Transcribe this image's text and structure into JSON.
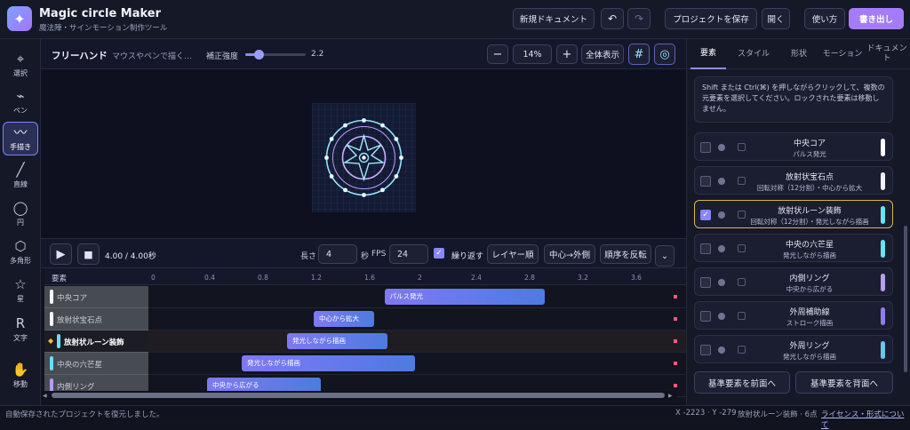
{
  "header": {
    "app_title": "Magic circle Maker",
    "app_subtitle": "魔法陣・サインモーション制作ツール",
    "new_doc": "新規ドキュメント",
    "undo": "↶",
    "redo": "↷",
    "save_project": "プロジェクトを保存",
    "open": "開く",
    "howto": "使い方",
    "export": "書き出し"
  },
  "tools": [
    {
      "icon": "⌖",
      "label": "選択"
    },
    {
      "icon": "⌁",
      "label": "ペン"
    },
    {
      "icon": "〰",
      "label": "手描き"
    },
    {
      "icon": "╱",
      "label": "直線"
    },
    {
      "icon": "◯",
      "label": "円"
    },
    {
      "icon": "⬡",
      "label": "多角形"
    },
    {
      "icon": "☆",
      "label": "星"
    },
    {
      "icon": "R",
      "label": "文字"
    },
    {
      "icon": "✋",
      "label": "移動"
    }
  ],
  "toolbar": {
    "mode_title": "フリーハンド",
    "mode_hint": "マウスやペンで描く…",
    "strength_label": "補正強度",
    "strength_value": "2.2",
    "strength_fraction": 0.22,
    "zoom_minus": "−",
    "zoom_value": "14%",
    "zoom_plus": "+",
    "fit_all": "全体表示"
  },
  "playback": {
    "time": "4.00 / 4.00秒",
    "length_label": "長さ",
    "length_value": "4",
    "sec_label": "秒",
    "fps_label": "FPS",
    "fps_value": "24",
    "repeat_label": "繰り返す",
    "layer_order": "レイヤー順",
    "center_out": "中心→外側",
    "reverse": "順序を反転",
    "more": "⌄"
  },
  "timeline": {
    "header_label": "要素",
    "ticks": [
      "0",
      "0.4",
      "0.8",
      "1.2",
      "1.6",
      "2",
      "2.4",
      "2.8",
      "3.2",
      "3.6"
    ],
    "rows": [
      {
        "name": "中央コア",
        "color": "#ffffff",
        "bar_label": "パルス発光",
        "start": 1.75,
        "end": 2.95,
        "selected": false
      },
      {
        "name": "放射状宝石点",
        "color": "#ffffff",
        "bar_label": "中心から拡大",
        "start": 1.22,
        "end": 1.67,
        "selected": false
      },
      {
        "name": "放射状ルーン装飾",
        "color": "#66e0f2",
        "bar_label": "発光しながら描画",
        "start": 1.02,
        "end": 1.77,
        "selected": true
      },
      {
        "name": "中央の六芒星",
        "color": "#66e0f2",
        "bar_label": "発光しながら描画",
        "start": 0.68,
        "end": 1.98,
        "selected": false
      },
      {
        "name": "内側リング",
        "color": "#b69cf5",
        "bar_label": "中央から広がる",
        "start": 0.42,
        "end": 1.27,
        "selected": false
      }
    ]
  },
  "right_panel": {
    "tabs": [
      "要素",
      "スタイル",
      "形状",
      "モーション",
      "ドキュメント"
    ],
    "info": "Shift または Ctrl(⌘) を押しながらクリックして、複数の元要素を選択してください。ロックされた要素は移動しません。",
    "elements": [
      {
        "name": "中央コア",
        "desc": "パルス発光",
        "color": "#ffffff",
        "checked": false
      },
      {
        "name": "放射状宝石点",
        "desc": "回転対称（12分割）・中心から拡大",
        "color": "#f4f0ff",
        "checked": false
      },
      {
        "name": "放射状ルーン装飾",
        "desc": "回転対称（12分割）・発光しながら描画",
        "color": "#67e3f2",
        "checked": true
      },
      {
        "name": "中央の六芒星",
        "desc": "発光しながら描画",
        "color": "#67e3f2",
        "checked": false
      },
      {
        "name": "内側リング",
        "desc": "中央から広がる",
        "color": "#b89cf6",
        "checked": false
      },
      {
        "name": "外周補助線",
        "desc": "ストローク描画",
        "color": "#8f7cf2",
        "checked": false
      },
      {
        "name": "外周リング",
        "desc": "発光しながら描画",
        "color": "#67c6ee",
        "checked": false
      }
    ],
    "to_front": "基準要素を前面へ",
    "to_back": "基準要素を背面へ"
  },
  "status": {
    "left": "自動保存されたプロジェクトを復元しました。",
    "coords": "X -2223 · Y -279",
    "selection": "放射状ルーン装飾 · 6点",
    "license": "ライセンス・形式について"
  },
  "colors": {
    "accent": "#8a8dff",
    "export": "#a57cf7",
    "glow": "#66e0f2"
  }
}
